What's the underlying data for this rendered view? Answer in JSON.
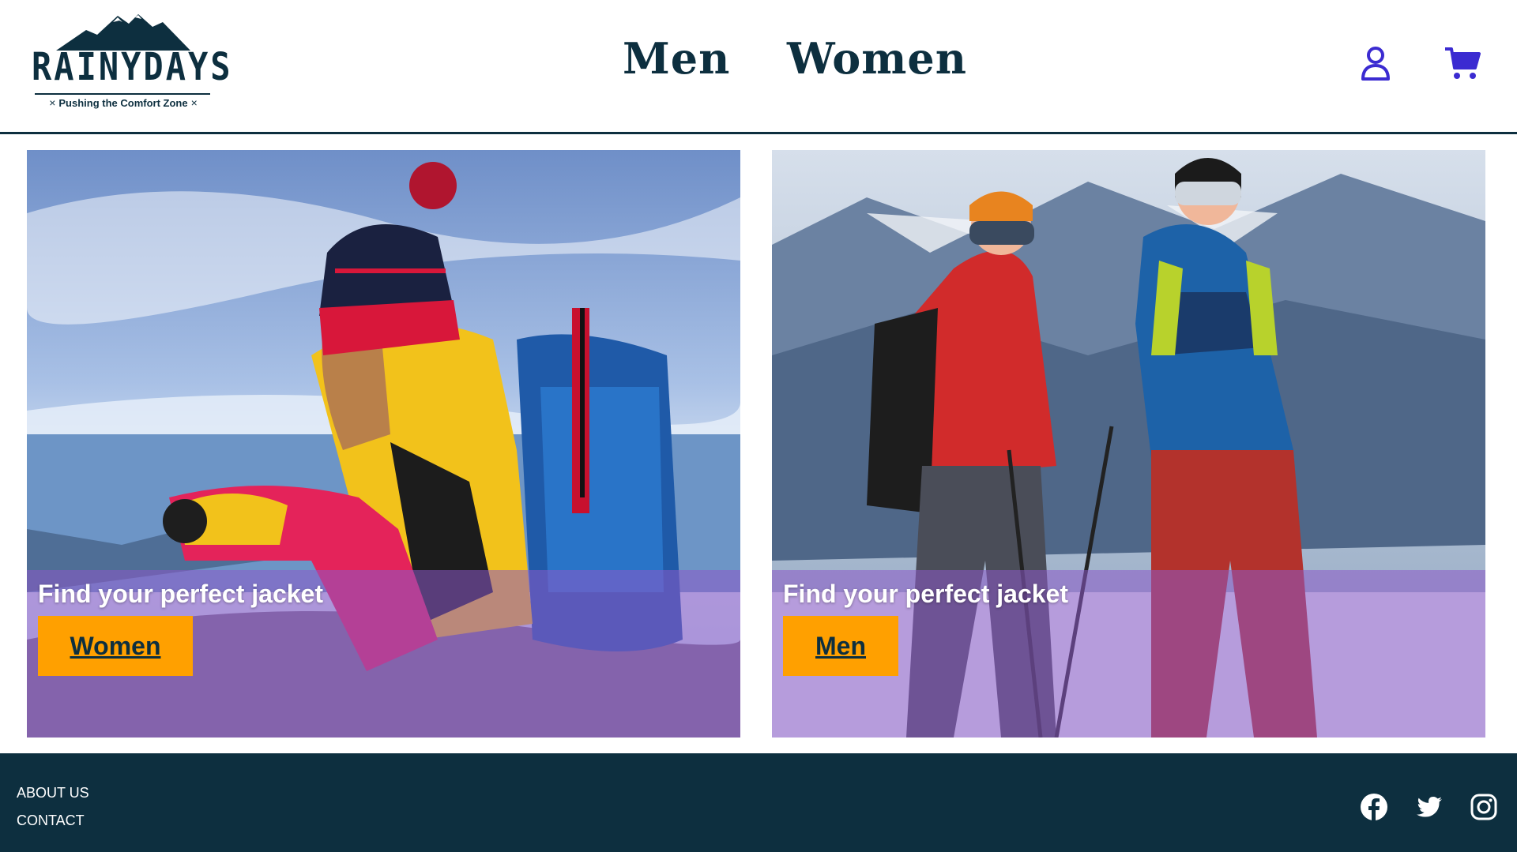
{
  "brand": {
    "name": "RAINYDAYS",
    "tagline": "Pushing the Comfort Zone",
    "tagline_mark": "×",
    "primary_color": "#0d2f3f",
    "accent_color": "#ffa000",
    "icon_color": "#3b2bd1"
  },
  "nav": {
    "men_label": "Men",
    "women_label": "Women"
  },
  "header_icons": {
    "account": "user-icon",
    "cart": "cart-icon"
  },
  "hero": {
    "women_card": {
      "headline": "Find your perfect jacket",
      "button_label": "Women"
    },
    "men_card": {
      "headline": "Find your perfect jacket",
      "button_label": "Men"
    }
  },
  "footer": {
    "about_label": "ABOUT US",
    "contact_label": "CONTACT",
    "social": [
      "facebook-icon",
      "twitter-icon",
      "instagram-icon"
    ]
  }
}
